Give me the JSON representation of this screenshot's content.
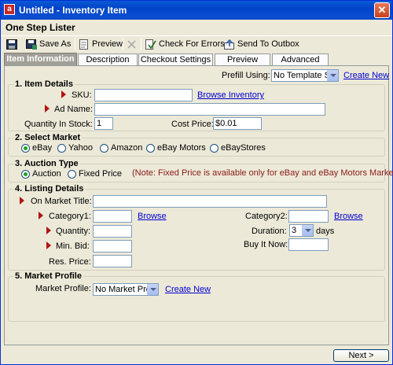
{
  "window": {
    "title": "Untitled - Inventory Item",
    "app_icon": "a"
  },
  "heading": "One Step Lister",
  "toolbar": {
    "save_as": "Save As",
    "preview": "Preview",
    "check_errors": "Check For Errors",
    "send_outbox": "Send To Outbox"
  },
  "tabs": [
    "Item Information",
    "Description",
    "Checkout Settings",
    "Preview",
    "Advanced"
  ],
  "prefill": {
    "label": "Prefill Using:",
    "value": "No Template Se",
    "create_new": "Create New"
  },
  "item_details": {
    "legend": "1. Item Details",
    "sku_label": "SKU:",
    "sku_value": "",
    "browse_inventory": "Browse Inventory",
    "ad_name_label": "Ad Name:",
    "ad_name_value": "",
    "qty_label": "Quantity In Stock:",
    "qty_value": "1",
    "cost_label": "Cost Price:",
    "cost_value": "$0.01"
  },
  "select_market": {
    "legend": "2. Select Market",
    "options": [
      "eBay",
      "Yahoo",
      "Amazon",
      "eBay Motors",
      "eBayStores"
    ],
    "selected": "eBay"
  },
  "auction_type": {
    "legend": "3. Auction Type",
    "options": [
      "Auction",
      "Fixed Price"
    ],
    "selected": "Auction",
    "note": "(Note: Fixed Price is available only for eBay and eBay Motors Market)"
  },
  "listing_details": {
    "legend": "4. Listing Details",
    "on_market_title": "On Market Title:",
    "category1": "Category1:",
    "category2": "Category2:",
    "browse": "Browse",
    "quantity": "Quantity:",
    "duration": "Duration:",
    "duration_value": "3",
    "days": "days",
    "min_bid": "Min. Bid:",
    "buy_it_now": "Buy It Now:",
    "res_price": "Res. Price:"
  },
  "market_profile": {
    "legend": "5. Market Profile",
    "label": "Market Profile:",
    "value": "No Market Profi",
    "create_new": "Create New"
  },
  "footer": {
    "next": "Next >"
  },
  "colors": {
    "titlebar": "#0a4fd2",
    "required_marker": "#b01414",
    "link": "#0000d0",
    "note": "#8b1a1a"
  }
}
